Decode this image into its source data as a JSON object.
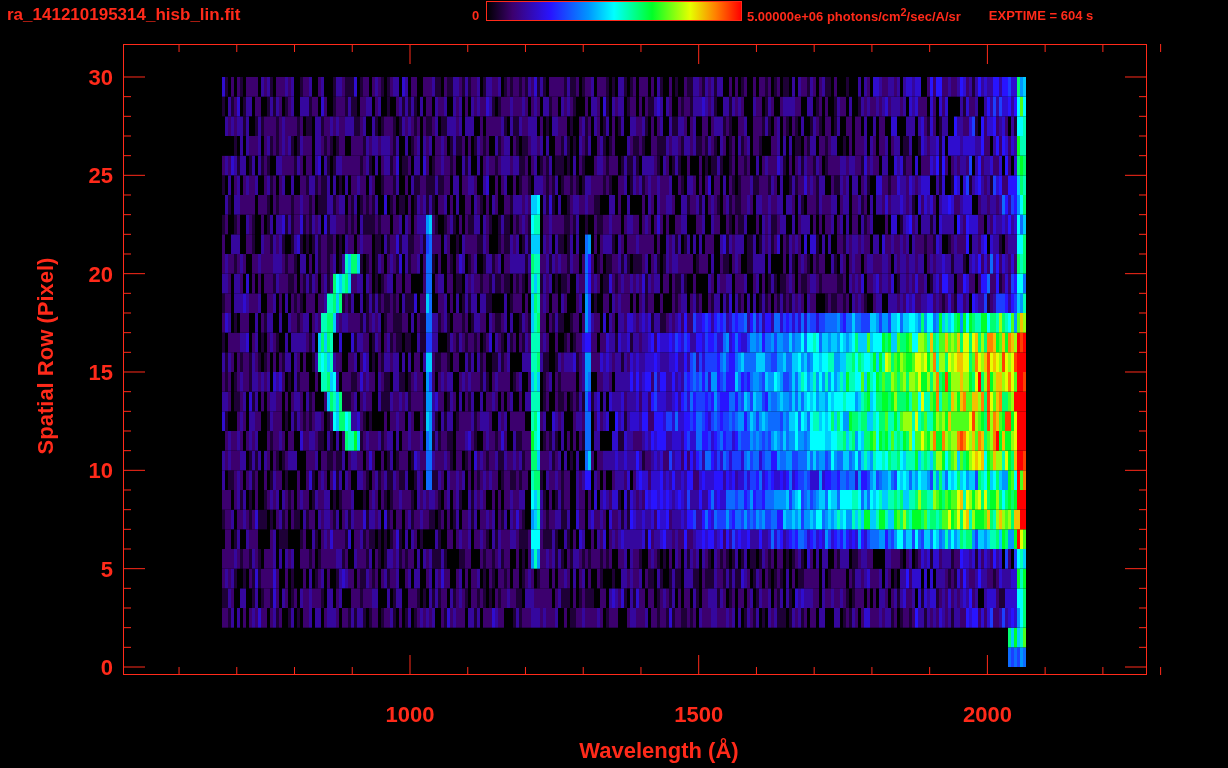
{
  "title": "ra_141210195314_hisb_lin.fit",
  "colorbar": {
    "min_label": "0",
    "max_label": "5.00000e+06 photons/cm$^{2}$/sec/A/sr"
  },
  "exposure": "EXPTIME = 604 s",
  "y_axis": {
    "label": "Spatial Row (Pixel)",
    "ticks": [
      "30",
      "25",
      "20",
      "15",
      "10",
      "5",
      "0"
    ]
  },
  "x_axis": {
    "label": "Wavelength (Å)",
    "ticks": [
      "1000",
      "1500",
      "2000"
    ]
  }
}
